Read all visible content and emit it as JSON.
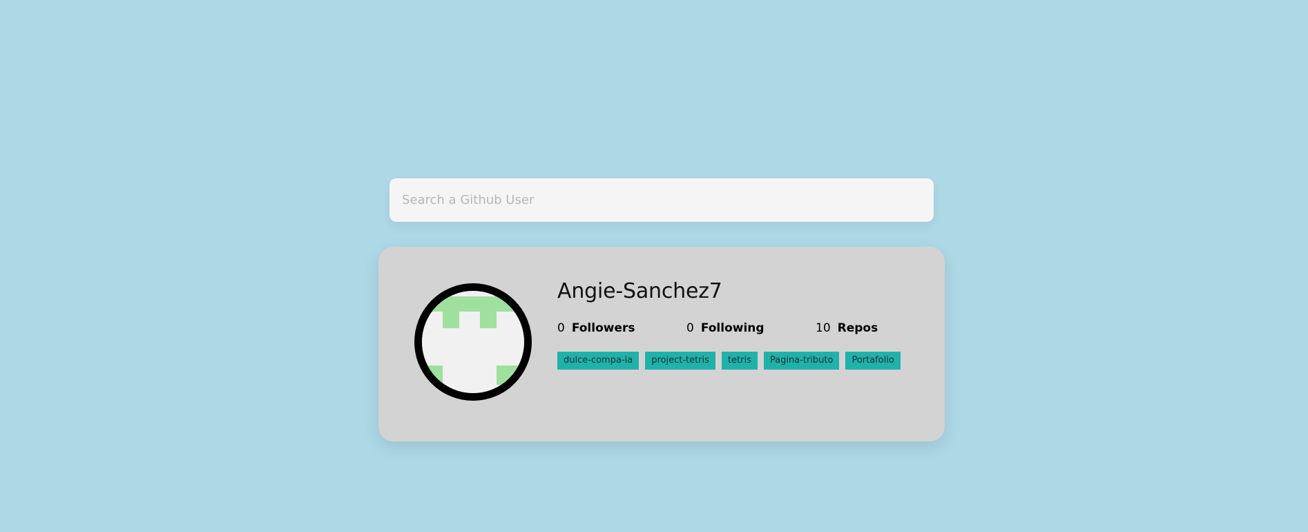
{
  "search": {
    "placeholder": "Search a Github User",
    "value": ""
  },
  "profile": {
    "username": "Angie-Sanchez7",
    "avatar_icon": "identicon",
    "avatar_colors": {
      "pattern": "#9fe09f",
      "background": "#f1f1f1",
      "border": "#000000"
    },
    "stats": {
      "followers": {
        "count": "0",
        "label": "Followers"
      },
      "following": {
        "count": "0",
        "label": "Following"
      },
      "repos": {
        "count": "10",
        "label": "Repos"
      }
    },
    "repos": [
      "dulce-compa-ia",
      "project-tetris",
      "tetris",
      "Pagina-tributo",
      "Portafolio"
    ]
  },
  "colors": {
    "page_background": "#add8e6",
    "card_background": "#d3d3d3",
    "search_background": "#f6f5f5",
    "repo_tag": "#20b2aa"
  }
}
